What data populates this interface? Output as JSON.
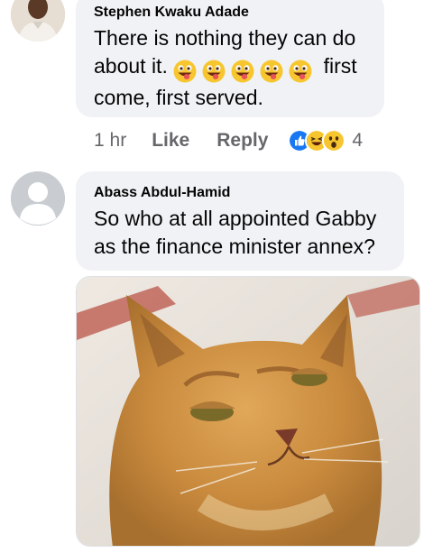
{
  "comments": [
    {
      "author": "Stephen Kwaku Adade",
      "text_start": "There is nothing they can do about it.",
      "text_end": "first come, first served.",
      "emojis": [
        "grinning-tongue-emoji",
        "grinning-tongue-emoji",
        "grinning-tongue-emoji",
        "grinning-tongue-emoji",
        "grinning-tongue-emoji"
      ],
      "time": "1 hr",
      "like_label": "Like",
      "reply_label": "Reply",
      "reactions": [
        "like-reaction-icon",
        "haha-reaction-icon",
        "wow-reaction-icon"
      ],
      "reaction_count": "4"
    },
    {
      "author": "Abass Abdul-Hamid",
      "text": "So who at all appointed Gabby as the finance minister annex?",
      "image": "cat-meme-photo"
    }
  ],
  "colors": {
    "bubble": "#f0f2f5",
    "meta_text": "#65676b",
    "like_blue": "#1877f2",
    "emoji_yellow": "#f7c62f"
  }
}
